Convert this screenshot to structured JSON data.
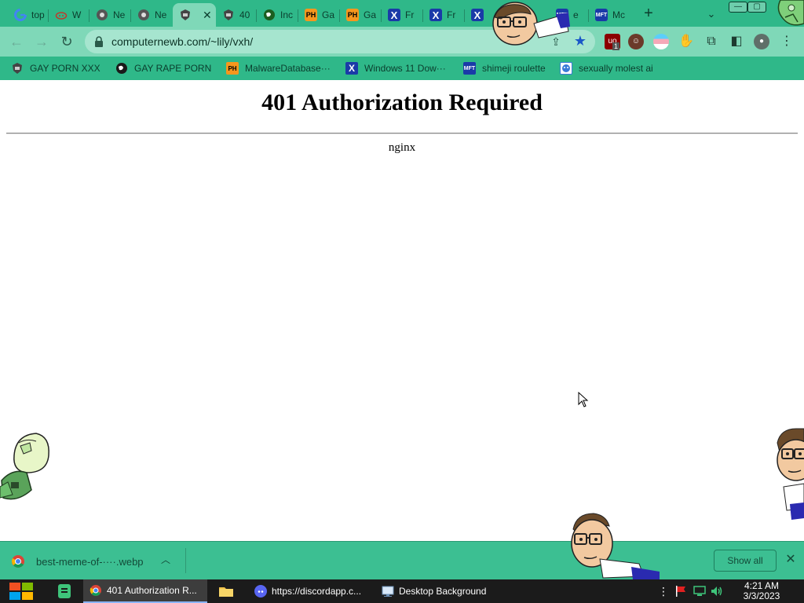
{
  "browser": {
    "tabs": [
      {
        "label": "top",
        "icon": "google-icon",
        "color": "#4285f4",
        "active": false
      },
      {
        "label": "W",
        "icon": "cloud-icon",
        "color": "#c0392b",
        "active": false
      },
      {
        "label": "Ne",
        "icon": "chrome-icon",
        "color": "#444444",
        "active": false
      },
      {
        "label": "Ne",
        "icon": "chrome-icon",
        "color": "#444444",
        "active": false
      },
      {
        "label": "",
        "icon": "shield-icon",
        "color": "#333333",
        "active": true
      },
      {
        "label": "40",
        "icon": "shield-icon",
        "color": "#333333",
        "active": false
      },
      {
        "label": "Inc",
        "icon": "globe-icon",
        "color": "#1b5e20",
        "active": false
      },
      {
        "label": "Ga",
        "icon": "ph-icon",
        "color": "#f7971d",
        "active": false
      },
      {
        "label": "Ga",
        "icon": "ph-icon",
        "color": "#f7971d",
        "active": false
      },
      {
        "label": "Fr",
        "icon": "x-icon",
        "color": "#1a3aa8",
        "active": false
      },
      {
        "label": "Fr",
        "icon": "x-icon",
        "color": "#1a3aa8",
        "active": false
      },
      {
        "label": "",
        "icon": "x-icon",
        "color": "#1a3aa8",
        "active": false
      },
      {
        "label": "e",
        "icon": "mft-icon",
        "color": "#1a3aa8",
        "active": false
      },
      {
        "label": "Mc",
        "icon": "mft-icon",
        "color": "#1a3aa8",
        "active": false
      }
    ],
    "new_tab_label": "+",
    "tab_search_label": "⌄",
    "address": "computernewb.com/~lily/vxh/",
    "extension_badge": "1",
    "bookmarks": [
      {
        "label": "GAY PORN XXX",
        "icon": "shield-icon"
      },
      {
        "label": "GAY RAPE PORN",
        "icon": "globe-icon"
      },
      {
        "label": "MalwareDatabase···",
        "icon": "ph-icon"
      },
      {
        "label": "Windows 11 Dow···",
        "icon": "x-icon"
      },
      {
        "label": "shimeji roulette",
        "icon": "mft-icon"
      },
      {
        "label": "sexually molest ai",
        "icon": "face-icon"
      }
    ]
  },
  "page": {
    "heading": "401 Authorization Required",
    "server": "nginx"
  },
  "downloads": {
    "file_name": "best-meme-of-····.webp",
    "show_all_label": "Show all",
    "close_label": "✕"
  },
  "taskbar": {
    "tasks": [
      {
        "label": "401 Authorization R...",
        "icon": "chrome-icon",
        "active": true
      },
      {
        "label": "https://discordapp.c...",
        "icon": "discord-icon",
        "active": false
      },
      {
        "label": "Desktop Background",
        "icon": "monitor-icon",
        "active": false
      }
    ],
    "time": "4:21 AM",
    "date": "3/3/2023"
  },
  "colors": {
    "tabstrip": "#2fb889",
    "toolbar": "#7fd8b8",
    "omnibox": "#a6e5cf",
    "download_bar": "#3cbf92",
    "taskbar": "#1b1b1b"
  }
}
